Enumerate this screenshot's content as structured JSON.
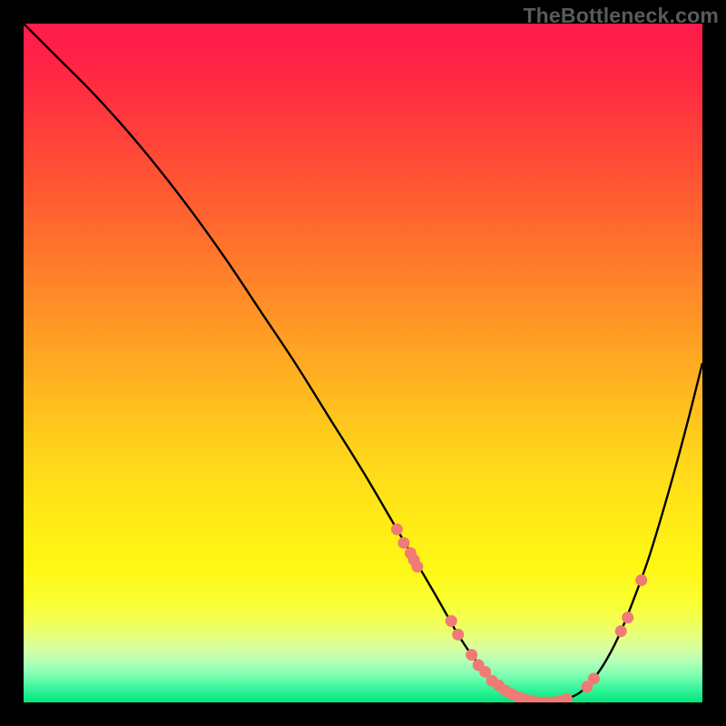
{
  "watermark": "TheBottleneck.com",
  "chart_data": {
    "type": "line",
    "title": "",
    "xlabel": "",
    "ylabel": "",
    "xlim": [
      0,
      100
    ],
    "ylim": [
      0,
      100
    ],
    "series": [
      {
        "name": "bottleneck-curve",
        "x": [
          0,
          5,
          10,
          15,
          20,
          25,
          30,
          35,
          40,
          45,
          50,
          55,
          60,
          62,
          64,
          66,
          68,
          70,
          72,
          74,
          76,
          78,
          80,
          82,
          84,
          86,
          88,
          90,
          92,
          94,
          96,
          98,
          100
        ],
        "y": [
          100,
          95,
          90,
          84.5,
          78.5,
          72,
          65,
          57.5,
          50,
          42,
          34,
          25.5,
          17,
          13.5,
          10,
          7,
          4.5,
          2.5,
          1.2,
          0.4,
          0,
          0,
          0.5,
          1.5,
          3.5,
          6.5,
          10.5,
          15.5,
          21,
          27.5,
          34.5,
          42,
          50
        ]
      }
    ],
    "markers": {
      "name": "sample-points",
      "x": [
        55,
        56,
        57,
        57.5,
        58,
        63,
        64,
        66,
        67,
        68,
        69,
        70,
        71,
        72,
        73,
        74,
        75,
        76,
        77,
        78,
        79,
        80,
        83,
        84,
        88,
        89,
        91
      ],
      "y": [
        25.5,
        23.5,
        22,
        21,
        20,
        12,
        10,
        7,
        5.5,
        4.5,
        3.2,
        2.5,
        1.7,
        1.2,
        0.7,
        0.4,
        0.2,
        0,
        0,
        0,
        0.2,
        0.5,
        2.3,
        3.5,
        10.5,
        12.5,
        18
      ]
    },
    "gradient_bands": [
      {
        "y": 100,
        "color": "#ff1a4b"
      },
      {
        "y": 95,
        "color": "#ff2246"
      },
      {
        "y": 90,
        "color": "#ff2e40"
      },
      {
        "y": 85,
        "color": "#ff3c3b"
      },
      {
        "y": 80,
        "color": "#ff4b36"
      },
      {
        "y": 75,
        "color": "#ff5a32"
      },
      {
        "y": 70,
        "color": "#ff6a2e"
      },
      {
        "y": 65,
        "color": "#ff7a2b"
      },
      {
        "y": 60,
        "color": "#ff8a28"
      },
      {
        "y": 55,
        "color": "#ff9a25"
      },
      {
        "y": 50,
        "color": "#ffaa22"
      },
      {
        "y": 45,
        "color": "#ffba1f"
      },
      {
        "y": 40,
        "color": "#ffca1c"
      },
      {
        "y": 35,
        "color": "#ffd81a"
      },
      {
        "y": 30,
        "color": "#ffe418"
      },
      {
        "y": 25,
        "color": "#ffee16"
      },
      {
        "y": 20,
        "color": "#fff714"
      },
      {
        "y": 15,
        "color": "#fbff30"
      },
      {
        "y": 12,
        "color": "#f2ff55"
      },
      {
        "y": 10,
        "color": "#e8ff78"
      },
      {
        "y": 8,
        "color": "#d6ffa0"
      },
      {
        "y": 6,
        "color": "#b4ffb8"
      },
      {
        "y": 4,
        "color": "#7dffb2"
      },
      {
        "y": 2,
        "color": "#36f59a"
      },
      {
        "y": 0,
        "color": "#00e67a"
      }
    ],
    "marker_color": "#ef7b74",
    "curve_color": "#000000"
  }
}
